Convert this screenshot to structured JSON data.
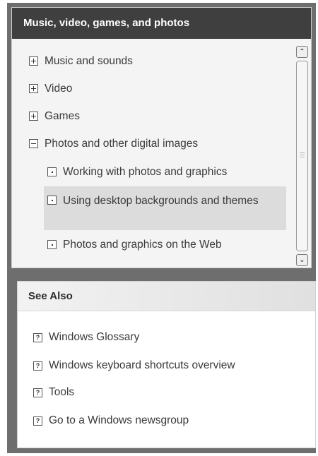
{
  "topic_panel": {
    "title": "Music, video, games, and photos",
    "items": [
      {
        "label": "Music and sounds",
        "icon": "expand-plus-icon"
      },
      {
        "label": "Video",
        "icon": "expand-plus-icon"
      },
      {
        "label": "Games",
        "icon": "expand-plus-icon"
      },
      {
        "label": "Photos and other digital images",
        "icon": "collapse-minus-icon"
      },
      {
        "label": "Working with photos and graphics",
        "icon": "topic-page-icon"
      },
      {
        "label": "Using desktop backgrounds and themes",
        "icon": "topic-page-icon"
      },
      {
        "label": "Photos and graphics on the Web",
        "icon": "topic-page-icon"
      }
    ],
    "scrollbar": {
      "up_glyph": "⌃",
      "down_glyph": "⌄"
    }
  },
  "see_also": {
    "title": "See Also",
    "icon_glyph": "?",
    "links": [
      {
        "label": "Windows Glossary"
      },
      {
        "label": "Windows keyboard shortcuts overview"
      },
      {
        "label": "Tools"
      },
      {
        "label": "Go to a Windows newsgroup"
      }
    ]
  }
}
